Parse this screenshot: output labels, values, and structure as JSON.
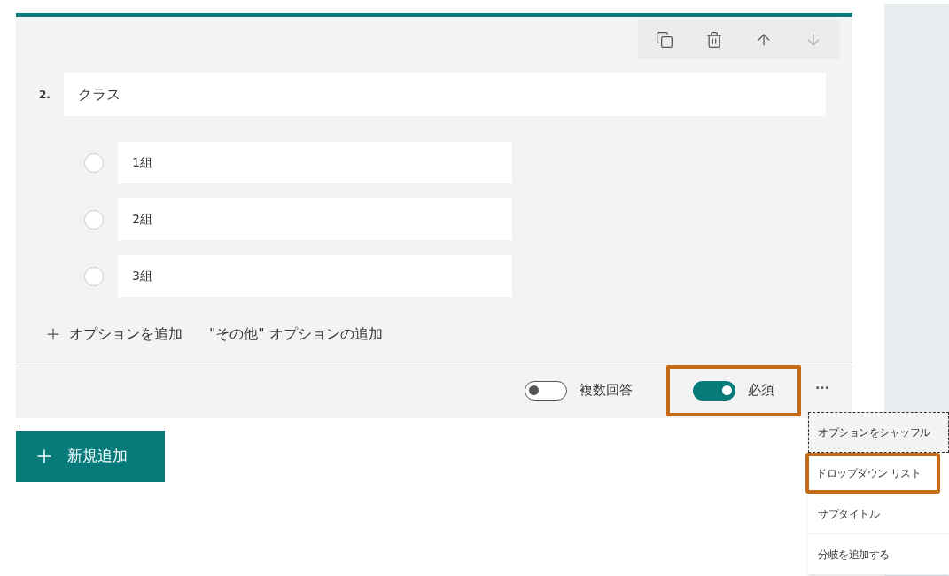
{
  "toolbar": [
    {
      "kind": "copy",
      "disabled": false
    },
    {
      "kind": "delete",
      "disabled": false
    },
    {
      "kind": "up",
      "disabled": false
    },
    {
      "kind": "down",
      "disabled": true
    }
  ],
  "question": {
    "number": "2.",
    "title": "クラス"
  },
  "options": [
    {
      "label": "1組",
      "selected": false
    },
    {
      "label": "2組",
      "selected": false
    },
    {
      "label": "3組",
      "selected": false
    }
  ],
  "add_option": "オプションを追加",
  "add_other": "\"その他\" オプションの追加",
  "toggles": [
    {
      "label": "複数回答",
      "on": false,
      "highlighted": false
    },
    {
      "label": "必須",
      "on": true,
      "highlighted": true
    }
  ],
  "more": "...",
  "new_button": "新規追加",
  "menu": [
    {
      "label": "オプションをシャッフル",
      "focused": true,
      "highlighted": false
    },
    {
      "label": "ドロップダウン リスト",
      "focused": false,
      "highlighted": true
    },
    {
      "label": "サブタイトル",
      "focused": false,
      "highlighted": false
    },
    {
      "label": "分岐を追加する",
      "focused": false,
      "highlighted": false
    }
  ]
}
